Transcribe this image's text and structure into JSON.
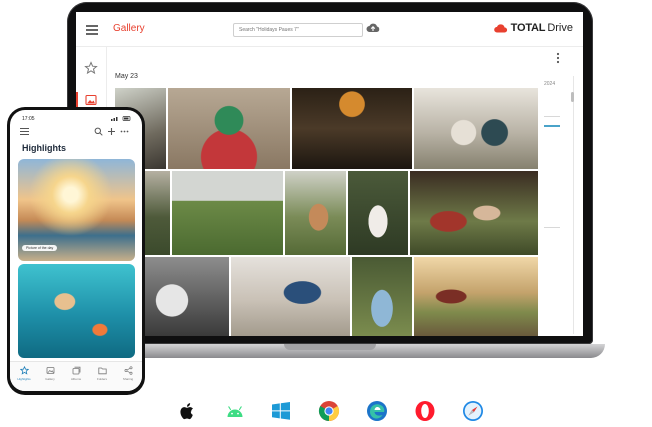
{
  "laptop": {
    "app_title": "Gallery",
    "search_placeholder": "Search \"Holidays Paues 7\"",
    "brand_total": "TOTAL",
    "brand_drive": "Drive",
    "date_label": "May 23",
    "timeline_year": "2024",
    "icons": [
      "menu-icon",
      "cloud-upload-icon",
      "star-icon",
      "photos-icon",
      "more-vertical-icon",
      "brand-cloud-icon"
    ]
  },
  "phone": {
    "status_time": "17:05",
    "title": "Highlights",
    "highlight_caption": "Picture of the day",
    "nav": [
      {
        "label": "Highlights"
      },
      {
        "label": "Gallery"
      },
      {
        "label": "Albums"
      },
      {
        "label": "Folders"
      },
      {
        "label": "Sharing"
      }
    ]
  },
  "platforms": [
    "apple-icon",
    "android-icon",
    "windows-icon",
    "chrome-icon",
    "edge-icon",
    "opera-icon",
    "safari-icon"
  ],
  "colors": {
    "accent_red": "#e8402f",
    "active_blue": "#1f7fb8",
    "laptop_frame": "#0f0f10"
  }
}
